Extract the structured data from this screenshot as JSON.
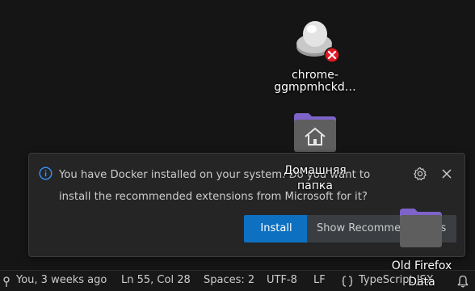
{
  "notification": {
    "message_line1": "You have Docker installed on your system. Do you want to",
    "message_line2": "install the recommended extensions from Microsoft for it?",
    "install_label": "Install",
    "show_label": "Show Recommendations",
    "icons": [
      "info-icon",
      "gear-icon",
      "close-icon"
    ]
  },
  "statusbar": {
    "blame": "You, 3 weeks ago",
    "position": "Ln 55, Col 28",
    "spaces": "Spaces: 2",
    "encoding": "UTF-8",
    "eol": "LF",
    "language": "TypeScript JSX"
  },
  "desktop": {
    "icons": [
      {
        "line1": "chrome-",
        "line2": "ggmpmhckd…"
      },
      {
        "line1": "Домашняя",
        "line2": "папка"
      },
      {
        "line1": "Old Firefox",
        "line2": "Data"
      }
    ]
  },
  "colors": {
    "accent": "#0e70c0",
    "info": "#3794ff",
    "error_badge": "#e01b24",
    "folder": "#7e63c9"
  }
}
